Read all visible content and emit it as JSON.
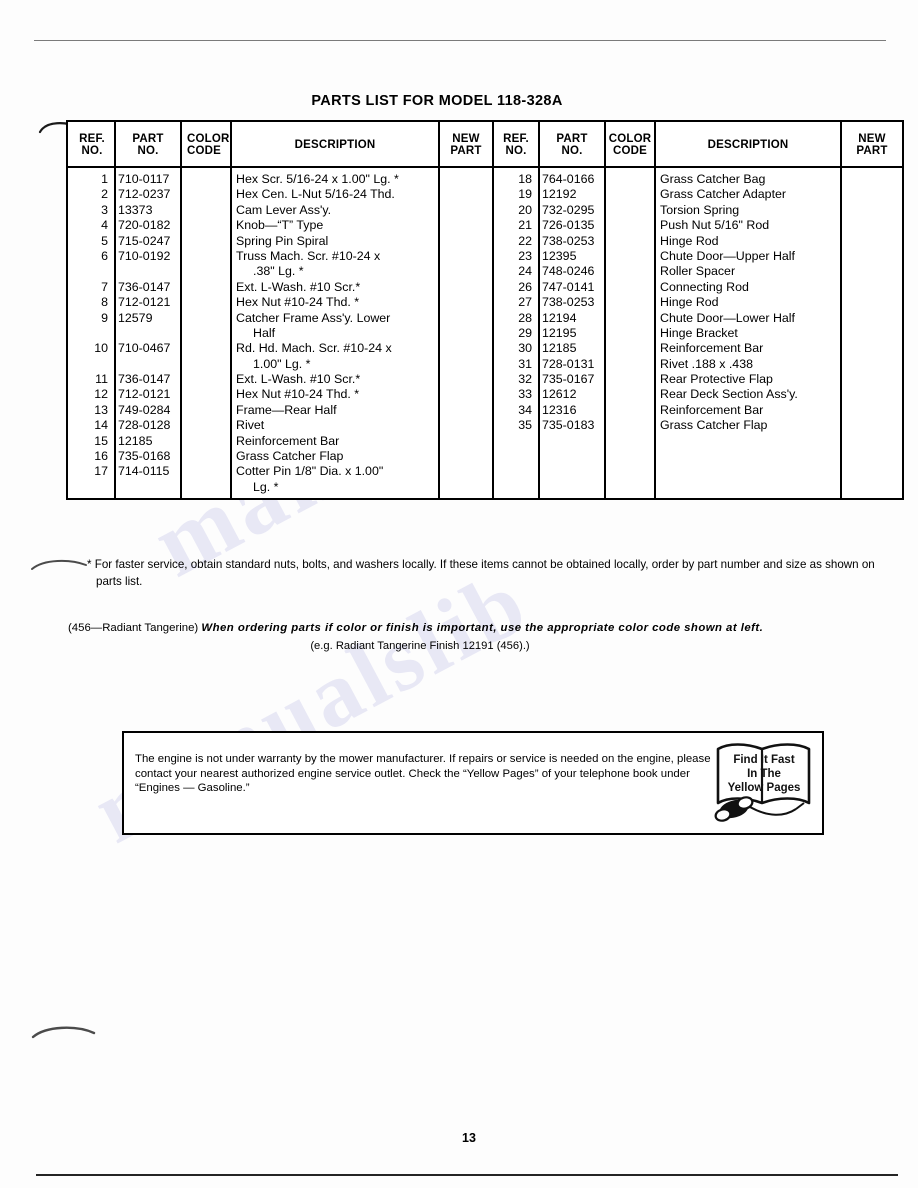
{
  "document": {
    "title": "PARTS LIST FOR MODEL 118-328A",
    "page_number": "13"
  },
  "table": {
    "headers": {
      "ref_no": "REF.\nNO.",
      "ref_no_line1": "REF.",
      "ref_no_line2": "NO.",
      "part_no_line1": "PART",
      "part_no_line2": "NO.",
      "color_code_line1": "COLOR",
      "color_code_line2": "CODE",
      "description": "DESCRIPTION",
      "new_part_line1": "NEW",
      "new_part_line2": "PART"
    },
    "left_rows": [
      {
        "ref": "1",
        "part": "710-0117",
        "color": "",
        "desc": "Hex Scr. 5/16-24 x 1.00\" Lg. *",
        "desc2": "",
        "new": ""
      },
      {
        "ref": "2",
        "part": "712-0237",
        "color": "",
        "desc": "Hex Cen. L-Nut 5/16-24 Thd.",
        "desc2": "",
        "new": ""
      },
      {
        "ref": "3",
        "part": "13373",
        "color": "",
        "desc": "Cam Lever Ass'y.",
        "desc2": "",
        "new": ""
      },
      {
        "ref": "4",
        "part": "720-0182",
        "color": "",
        "desc": "Knob—“T” Type",
        "desc2": "",
        "new": ""
      },
      {
        "ref": "5",
        "part": "715-0247",
        "color": "",
        "desc": "Spring Pin Spiral",
        "desc2": "",
        "new": ""
      },
      {
        "ref": "6",
        "part": "710-0192",
        "color": "",
        "desc": "Truss Mach. Scr. #10-24 x",
        "desc2": ".38\" Lg. *",
        "new": ""
      },
      {
        "ref": "7",
        "part": "736-0147",
        "color": "",
        "desc": "Ext. L-Wash. #10 Scr.*",
        "desc2": "",
        "new": ""
      },
      {
        "ref": "8",
        "part": "712-0121",
        "color": "",
        "desc": "Hex Nut #10-24 Thd. *",
        "desc2": "",
        "new": ""
      },
      {
        "ref": "9",
        "part": "12579",
        "color": "",
        "desc": "Catcher Frame Ass'y. Lower",
        "desc2": "Half",
        "new": ""
      },
      {
        "ref": "10",
        "part": "710-0467",
        "color": "",
        "desc": "Rd. Hd. Mach. Scr. #10-24 x",
        "desc2": "1.00\" Lg. *",
        "new": ""
      },
      {
        "ref": "11",
        "part": "736-0147",
        "color": "",
        "desc": "Ext. L-Wash. #10 Scr.*",
        "desc2": "",
        "new": ""
      },
      {
        "ref": "12",
        "part": "712-0121",
        "color": "",
        "desc": "Hex Nut #10-24 Thd. *",
        "desc2": "",
        "new": ""
      },
      {
        "ref": "13",
        "part": "749-0284",
        "color": "",
        "desc": "Frame—Rear Half",
        "desc2": "",
        "new": ""
      },
      {
        "ref": "14",
        "part": "728-0128",
        "color": "",
        "desc": "Rivet",
        "desc2": "",
        "new": ""
      },
      {
        "ref": "15",
        "part": "12185",
        "color": "",
        "desc": "Reinforcement Bar",
        "desc2": "",
        "new": ""
      },
      {
        "ref": "16",
        "part": "735-0168",
        "color": "",
        "desc": "Grass Catcher Flap",
        "desc2": "",
        "new": ""
      },
      {
        "ref": "17",
        "part": "714-0115",
        "color": "",
        "desc": "Cotter Pin 1/8\" Dia. x 1.00\"",
        "desc2": "Lg. *",
        "new": ""
      }
    ],
    "right_rows": [
      {
        "ref": "18",
        "part": "764-0166",
        "color": "",
        "desc": "Grass Catcher Bag",
        "new": ""
      },
      {
        "ref": "19",
        "part": "12192",
        "color": "",
        "desc": "Grass Catcher Adapter",
        "new": ""
      },
      {
        "ref": "20",
        "part": "732-0295",
        "color": "",
        "desc": "Torsion Spring",
        "new": ""
      },
      {
        "ref": "21",
        "part": "726-0135",
        "color": "",
        "desc": "Push Nut 5/16\" Rod",
        "new": ""
      },
      {
        "ref": "22",
        "part": "738-0253",
        "color": "",
        "desc": "Hinge Rod",
        "new": ""
      },
      {
        "ref": "23",
        "part": "12395",
        "color": "",
        "desc": "Chute Door—Upper Half",
        "new": ""
      },
      {
        "ref": "24",
        "part": "748-0246",
        "color": "",
        "desc": "Roller Spacer",
        "new": ""
      },
      {
        "ref": "26",
        "part": "747-0141",
        "color": "",
        "desc": "Connecting Rod",
        "new": ""
      },
      {
        "ref": "27",
        "part": "738-0253",
        "color": "",
        "desc": "Hinge Rod",
        "new": ""
      },
      {
        "ref": "28",
        "part": "12194",
        "color": "",
        "desc": "Chute Door—Lower Half",
        "new": ""
      },
      {
        "ref": "29",
        "part": "12195",
        "color": "",
        "desc": "Hinge Bracket",
        "new": ""
      },
      {
        "ref": "30",
        "part": "12185",
        "color": "",
        "desc": "Reinforcement Bar",
        "new": ""
      },
      {
        "ref": "31",
        "part": "728-0131",
        "color": "",
        "desc": "Rivet .188 x .438",
        "new": ""
      },
      {
        "ref": "32",
        "part": "735-0167",
        "color": "",
        "desc": "Rear Protective Flap",
        "new": ""
      },
      {
        "ref": "33",
        "part": "12612",
        "color": "",
        "desc": "Rear Deck Section Ass'y.",
        "new": ""
      },
      {
        "ref": "34",
        "part": "12316",
        "color": "",
        "desc": "Reinforcement Bar",
        "new": ""
      },
      {
        "ref": "35",
        "part": "735-0183",
        "color": "",
        "desc": "Grass Catcher Flap",
        "new": ""
      }
    ]
  },
  "notes": {
    "star_note": "* For faster service, obtain standard nuts, bolts, and washers locally. If these items cannot be obtained locally, order by part number and size as shown on parts list.",
    "color_code_lead": "(456—Radiant Tangerine)",
    "color_code_emphasis": "When ordering parts if color or finish is important, use the appropriate color code shown at left.",
    "color_code_example": "(e.g. Radiant Tangerine Finish 12191 (456).)"
  },
  "warranty": {
    "text": "The engine is not under warranty by the mower manufacturer. If repairs or service is needed on the engine, please contact your nearest authorized engine service outlet. Check the “Yellow Pages” of your telephone book under “Engines — Gasoline.”",
    "emblem": {
      "line1": "Find It Fast",
      "line2": "In The",
      "line3": "Yellow Pages",
      "icon": "open-book-with-telephone-icon"
    }
  },
  "watermark": {
    "line1": "manualslib.com",
    "line2": "manualslib"
  }
}
